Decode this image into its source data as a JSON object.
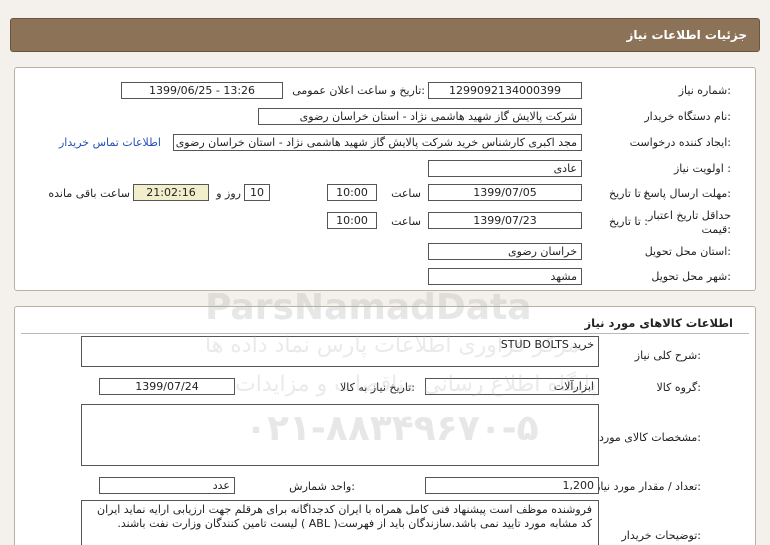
{
  "header": {
    "title": "جزئیات اطلاعات نیاز"
  },
  "watermark": {
    "brand": "ParsNamadData",
    "line1": "مرکز فراوری اطلاعات پارس نماد داده ها",
    "line2": "پایگاه اطلاع رسانی مناقصات و مزایدات",
    "phone": "۰۲۱-۸۸۳۴۹۶۷۰-۵"
  },
  "info": {
    "need_number_label": "شماره نیاز:",
    "need_number": "1299092134000399",
    "announce_label": "تاریخ و ساعت اعلان عمومی:",
    "announce_value": "1399/06/25 - 13:26",
    "buyer_label": "نام دستگاه خریدار:",
    "buyer_value": "شرکت پالایش گاز شهید هاشمی نژاد - استان خراسان رضوی",
    "creator_label": "ایجاد کننده درخواست:",
    "creator_value": "مجد اکبری کارشناس خرید شرکت پالایش گاز شهید هاشمی نژاد - استان خراسان رضوی",
    "contact_link": "اطلاعات تماس خریدار",
    "priority_label": "اولویت نیاز :",
    "priority_value": "عادی",
    "deadline_label": "مهلت ارسال پاسخ:",
    "to_date_label": "تا تاریخ :",
    "deadline_date": "1399/07/05",
    "time_label": "ساعت",
    "deadline_time": "10:00",
    "days_value": "10",
    "days_label": "روز و",
    "remaining_time": "21:02:16",
    "remaining_label": "ساعت باقی مانده",
    "validity_label_1": "حداقل تاریخ اعتبار",
    "validity_label_2": "قیمت:",
    "validity_date": "1399/07/23",
    "validity_time": "10:00",
    "province_label": "استان محل تحویل:",
    "province_value": "خراسان رضوی",
    "city_label": "شهر محل تحویل:",
    "city_value": "مشهد"
  },
  "goods": {
    "section_title": "اطلاعات کالاهای مورد نیاز",
    "description_label": "شرح کلی نیاز:",
    "description_value": "خرید STUD BOLTS",
    "group_label": "گروه کالا:",
    "group_value": "ابزارآلات",
    "need_date_label": "تاریخ نیاز به کالا:",
    "need_date_value": "1399/07/24",
    "specs_label": "مشخصات کالای مورد نیاز:",
    "specs_value": "",
    "quantity_label": "تعداد / مقدار مورد نیاز:",
    "quantity_value": "1,200",
    "unit_label": "واحد شمارش:",
    "unit_value": "عدد",
    "buyer_notes_label": "توضیحات خریدار:",
    "buyer_notes_value": "فروشنده موظف است پیشنهاد فنی کامل همراه با ایران کدجداگانه برای هرقلم جهت ارزیابی ارایه نماید ایران کد مشابه مورد تایید نمی باشد.سازندگان باید از فهرست( ABL ) لیست تامین کنندگان وزارت نفت باشند."
  }
}
